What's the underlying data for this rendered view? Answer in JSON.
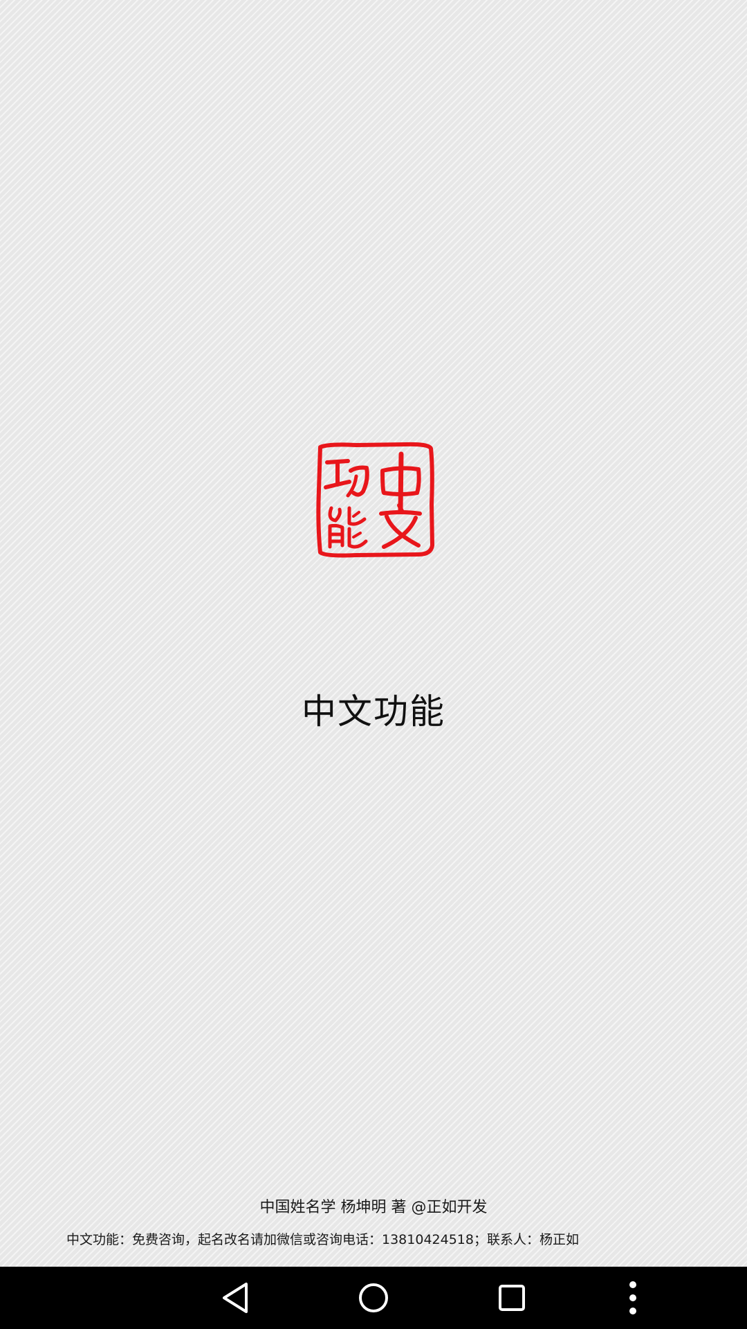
{
  "splash": {
    "logo": {
      "icon": "seal-stamp-icon",
      "characters": "中文功能",
      "color": "#e8161b"
    },
    "app_title": "中文功能",
    "credit": "中国姓名学 杨坤明 著 @正如开发",
    "contact": "中文功能：免费咨询，起名改名请加微信或咨询电话：13810424518；联系人：杨正如"
  },
  "navigation_bar": {
    "back": {
      "icon": "back-triangle-icon"
    },
    "home": {
      "icon": "home-circle-icon"
    },
    "recents": {
      "icon": "recents-square-icon"
    },
    "more": {
      "icon": "more-vertical-icon"
    }
  }
}
